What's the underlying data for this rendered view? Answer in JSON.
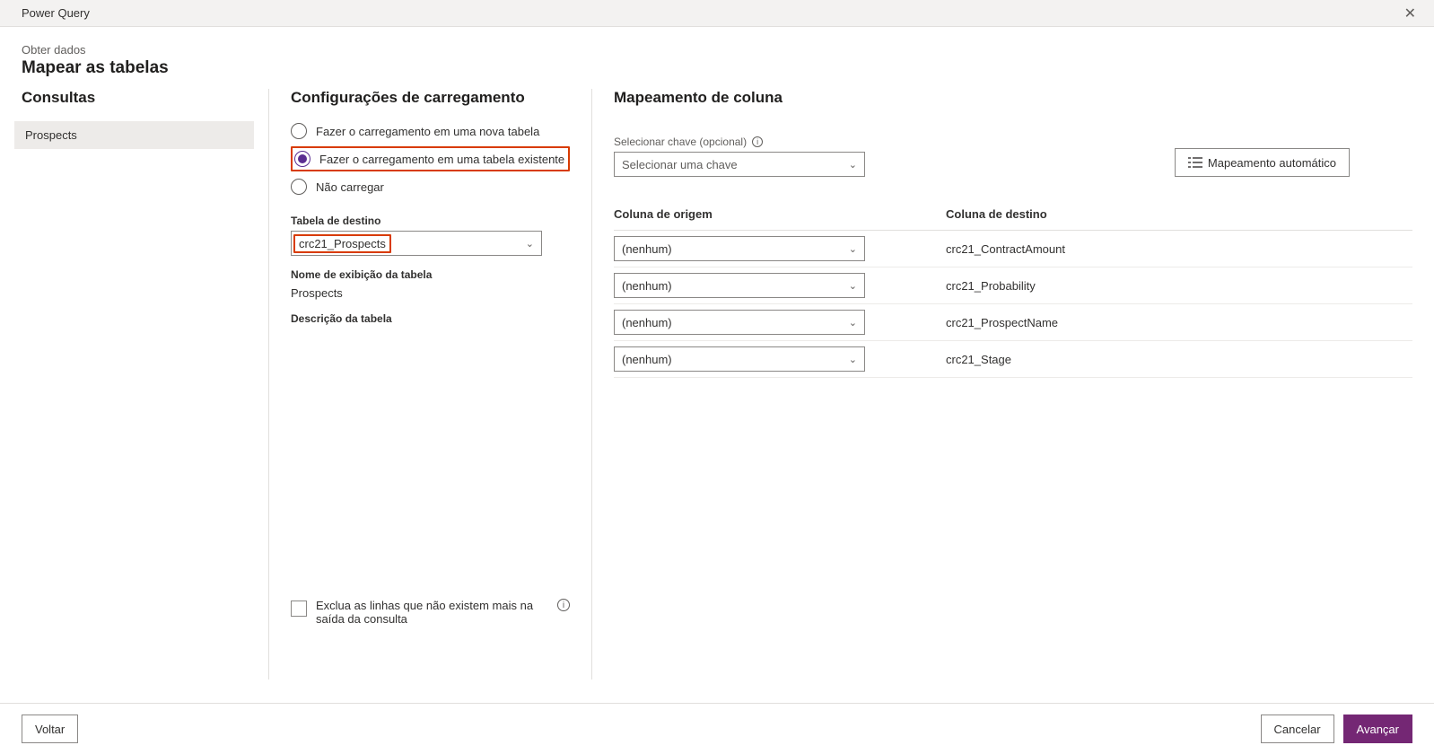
{
  "window": {
    "title": "Power Query"
  },
  "breadcrumb": "Obter dados",
  "page_title": "Mapear as tabelas",
  "left": {
    "title": "Consultas",
    "items": [
      "Prospects"
    ]
  },
  "mid": {
    "title": "Configurações de carregamento",
    "radios": {
      "new_table": "Fazer o carregamento em uma nova tabela",
      "existing_table": "Fazer o carregamento em uma tabela existente",
      "no_load": "Não carregar",
      "selected": "existing_table"
    },
    "dest_label": "Tabela de destino",
    "dest_value": "crc21_Prospects",
    "display_name_label": "Nome de exibição da tabela",
    "display_name_value": "Prospects",
    "desc_label": "Descrição da tabela",
    "desc_value": "",
    "exclude_label": "Exclua as linhas que não existem mais na saída da consulta"
  },
  "right": {
    "title": "Mapeamento de coluna",
    "select_key_label": "Selecionar chave (opcional)",
    "select_key_placeholder": "Selecionar uma chave",
    "auto_map_btn": "Mapeamento automático",
    "col_header_src": "Coluna de origem",
    "col_header_dst": "Coluna de destino",
    "rows": [
      {
        "src": "(nenhum)",
        "dst": "crc21_ContractAmount"
      },
      {
        "src": "(nenhum)",
        "dst": "crc21_Probability"
      },
      {
        "src": "(nenhum)",
        "dst": "crc21_ProspectName"
      },
      {
        "src": "(nenhum)",
        "dst": "crc21_Stage"
      }
    ]
  },
  "footer": {
    "back": "Voltar",
    "cancel": "Cancelar",
    "next": "Avançar"
  }
}
